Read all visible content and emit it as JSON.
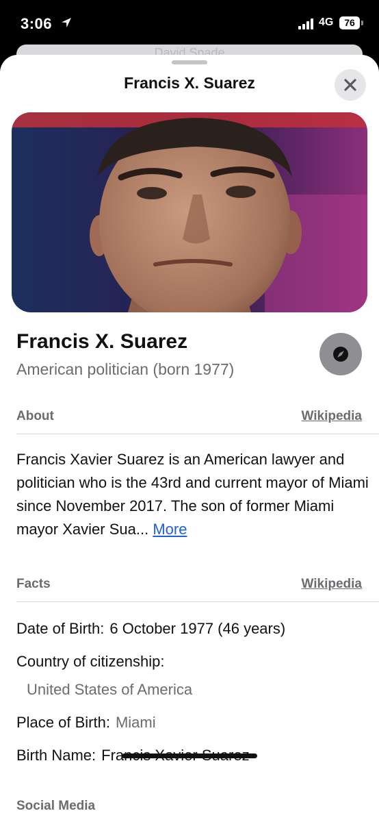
{
  "status": {
    "time": "3:06",
    "network": "4G",
    "battery": "76"
  },
  "background_card": {
    "text": "David Spade"
  },
  "sheet": {
    "title": "Francis X. Suarez"
  },
  "entity": {
    "name": "Francis X. Suarez",
    "description": "American politician (born 1977)"
  },
  "about": {
    "heading": "About",
    "source_link": "Wikipedia",
    "text": "Francis Xavier Suarez is an American lawyer and politician who is the 43rd and current mayor of Miami since November 2017. The son of former Miami mayor Xavier Sua...",
    "more_label": "More"
  },
  "facts": {
    "heading": "Facts",
    "source_link": "Wikipedia",
    "items": [
      {
        "label": "Date of Birth:",
        "value": "6 October 1977 (46 years)"
      },
      {
        "label": "Country of citizenship:",
        "value": "United States of America"
      },
      {
        "label": "Place of Birth:",
        "value": "Miami"
      },
      {
        "label": "Birth Name:",
        "value": "Francis Xavier Suarez"
      }
    ]
  },
  "social": {
    "heading": "Social Media"
  },
  "icons": {
    "location": "location-arrow-icon",
    "signal": "cellular-signal-icon",
    "close": "close-icon",
    "compass": "compass-icon"
  },
  "colors": {
    "link_blue": "#2060d9",
    "secondary_gray": "#6b6b70"
  }
}
